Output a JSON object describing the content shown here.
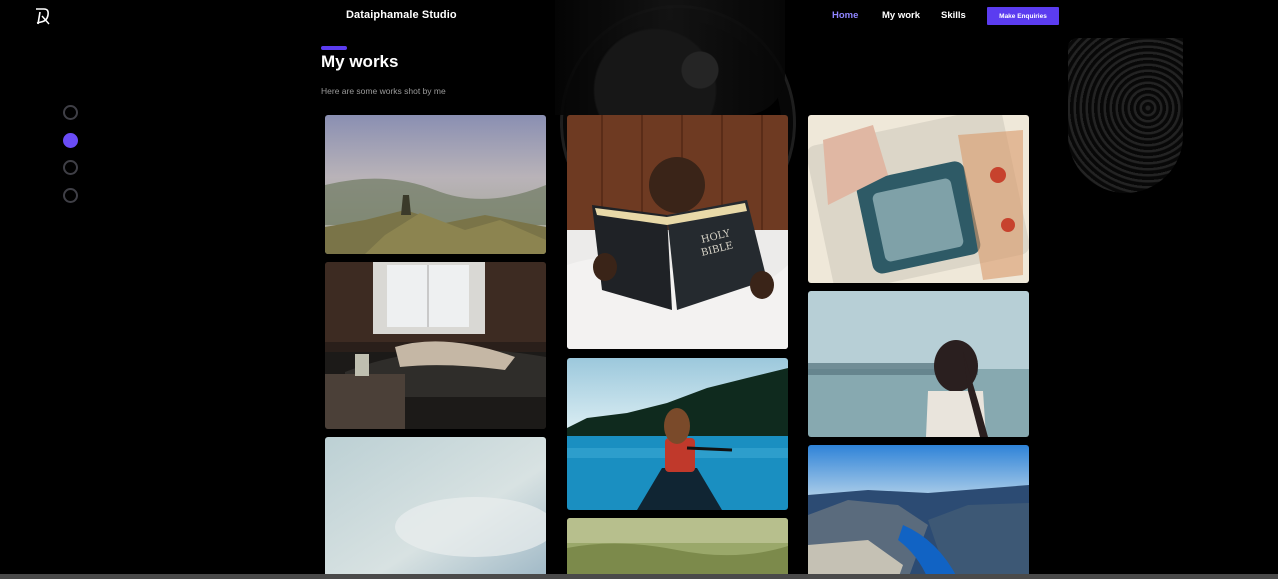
{
  "nav": {
    "brand": "Dataiphamale Studio",
    "links": [
      {
        "label": "Home",
        "active": true
      },
      {
        "label": "My work",
        "active": false
      },
      {
        "label": "Skills",
        "active": false
      }
    ],
    "cta_label": "Make Enquiries",
    "accent_color": "#5b3cf0"
  },
  "sidenav": {
    "dots": [
      {
        "active": false
      },
      {
        "active": true
      },
      {
        "active": false
      },
      {
        "active": false
      }
    ]
  },
  "section": {
    "title": "My works",
    "subtitle": "Here are some works shot by me"
  }
}
